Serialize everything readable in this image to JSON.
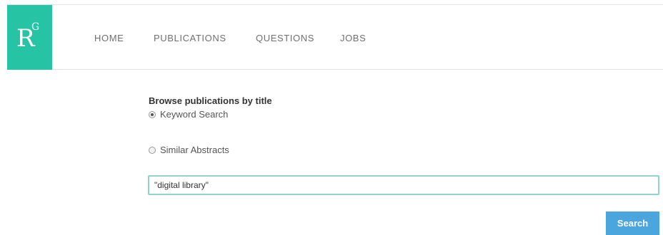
{
  "header": {
    "logo": {
      "letter": "R",
      "superscript": "G",
      "color": "#26c4a4"
    },
    "nav": [
      {
        "label": "HOME"
      },
      {
        "label": "PUBLICATIONS"
      },
      {
        "label": "QUESTIONS"
      },
      {
        "label": "JOBS"
      }
    ]
  },
  "browse": {
    "title": "Browse publications by title",
    "options": [
      {
        "label": "Keyword Search",
        "selected": true
      },
      {
        "label": "Similar Abstracts",
        "selected": false
      }
    ],
    "query": "\"digital library\"",
    "search_label": "Search",
    "search_button_color": "#4aa6dc",
    "input_border_color": "#8fd5cc"
  }
}
